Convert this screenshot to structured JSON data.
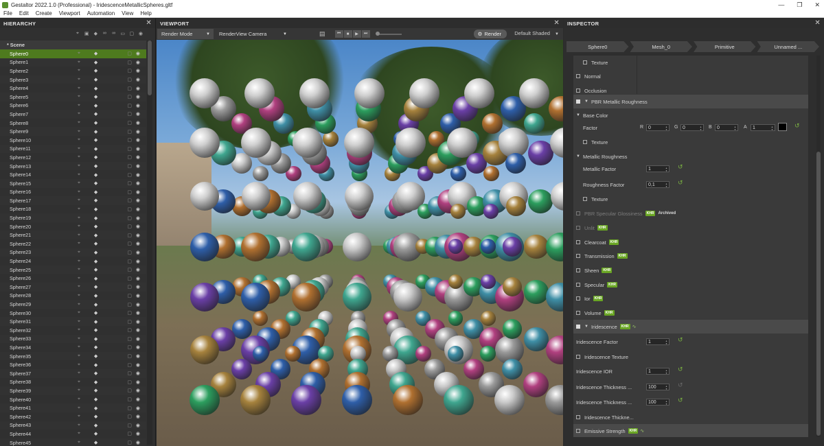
{
  "window": {
    "title": "Gestaltor 2022.1.0 (Professional) - IridescenceMetallicSpheres.gltf",
    "controls": [
      "—",
      "❐",
      "✕"
    ]
  },
  "menu": [
    "File",
    "Edit",
    "Create",
    "Viewport",
    "Automation",
    "View",
    "Help"
  ],
  "hierarchy": {
    "header": "HIERARCHY",
    "scene_label": "* Scene",
    "items": [
      "Sphere0",
      "Sphere1",
      "Sphere2",
      "Sphere3",
      "Sphere4",
      "Sphere5",
      "Sphere6",
      "Sphere7",
      "Sphere8",
      "Sphere9",
      "Sphere10",
      "Sphere11",
      "Sphere12",
      "Sphere13",
      "Sphere14",
      "Sphere15",
      "Sphere16",
      "Sphere17",
      "Sphere18",
      "Sphere19",
      "Sphere20",
      "Sphere21",
      "Sphere22",
      "Sphere23",
      "Sphere24",
      "Sphere25",
      "Sphere26",
      "Sphere27",
      "Sphere28",
      "Sphere29",
      "Sphere30",
      "Sphere31",
      "Sphere32",
      "Sphere33",
      "Sphere34",
      "Sphere35",
      "Sphere36",
      "Sphere37",
      "Sphere38",
      "Sphere39",
      "Sphere40",
      "Sphere41",
      "Sphere42",
      "Sphere43",
      "Sphere44",
      "Sphere45"
    ],
    "selected": "Sphere0"
  },
  "viewport": {
    "header": "VIEWPORT",
    "render_mode": "Render Mode",
    "camera": "RenderView Camera",
    "render_button": "Render",
    "shading": "Default Shaded"
  },
  "inspector": {
    "header": "INSPECTOR",
    "breadcrumbs": [
      "Sphere0",
      "Mesh_0",
      "Primitive",
      "Unnamed ..."
    ],
    "texture_label": "Texture",
    "normal": "Normal",
    "occlusion": "Occlusion",
    "pbr_mr": "PBR Metallic Roughness",
    "base_color": "Base Color",
    "factor": "Factor",
    "r": "R",
    "g": "G",
    "b": "B",
    "a": "A",
    "r_val": "0",
    "g_val": "0",
    "b_val": "0",
    "a_val": "1",
    "base_texture": "Texture",
    "metallic_roughness": "Metallic Roughness",
    "metallic_factor": "Metallic Factor",
    "metallic_factor_val": "1",
    "roughness_factor": "Roughness Factor",
    "roughness_factor_val": "0,1",
    "mr_texture": "Texture",
    "pbr_sg": "PBR Specular Glossiness",
    "khr": "KHR",
    "archived": "Archived",
    "unlit": "Unlit",
    "clearcoat": "Clearcoat",
    "transmission": "Transmission",
    "sheen": "Sheen",
    "specular": "Specular",
    "ior": "Ior",
    "volume": "Volume",
    "iridescence": "Iridescence",
    "irid_factor": "Iridescence Factor",
    "irid_factor_val": "1",
    "irid_texture": "Iridescence Texture",
    "irid_ior": "Iridescence IOR",
    "irid_ior_val": "1",
    "irid_thick1": "Iridescence Thickness ...",
    "irid_thick1_val": "100",
    "irid_thick2": "Iridescence Thickness ...",
    "irid_thick2_val": "100",
    "irid_thick_tex": "Iridescence Thickne...",
    "emissive_strength": "Emissive Strength"
  },
  "colors": {
    "selection": "#4e7a1e",
    "khr_badge": "#6aa624",
    "reset_arrow": "#7cb342"
  }
}
